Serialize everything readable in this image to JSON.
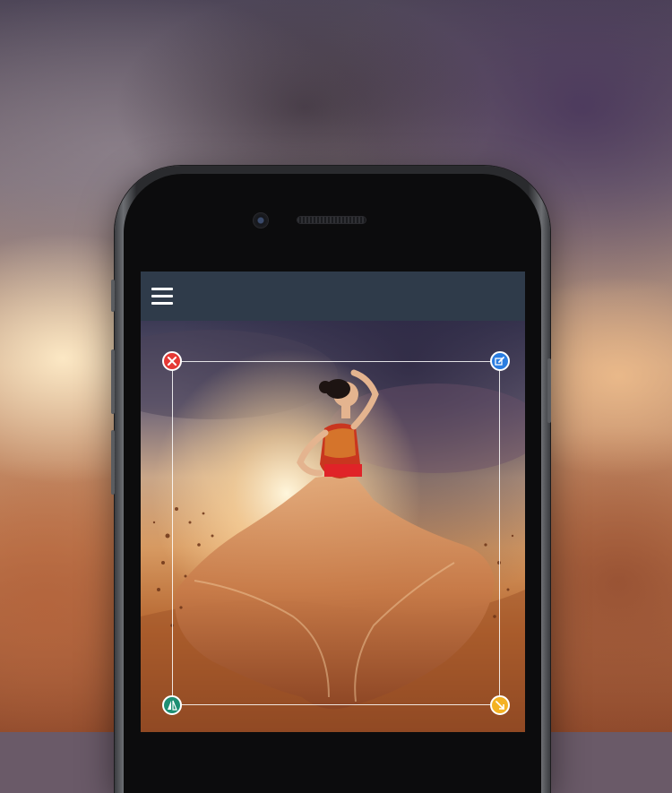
{
  "app": {
    "toolbar": {
      "menu_icon": "hamburger-menu-icon",
      "background_color": "#2f3b4a"
    },
    "sticker_controls": {
      "delete_icon": "close-icon",
      "edit_icon": "edit-icon",
      "flip_icon": "flip-icon",
      "resize_icon": "resize-icon",
      "colors": {
        "delete": "#e53935",
        "edit": "#2b7de0",
        "flip": "#1e8f73",
        "resize": "#f4b223"
      }
    }
  }
}
